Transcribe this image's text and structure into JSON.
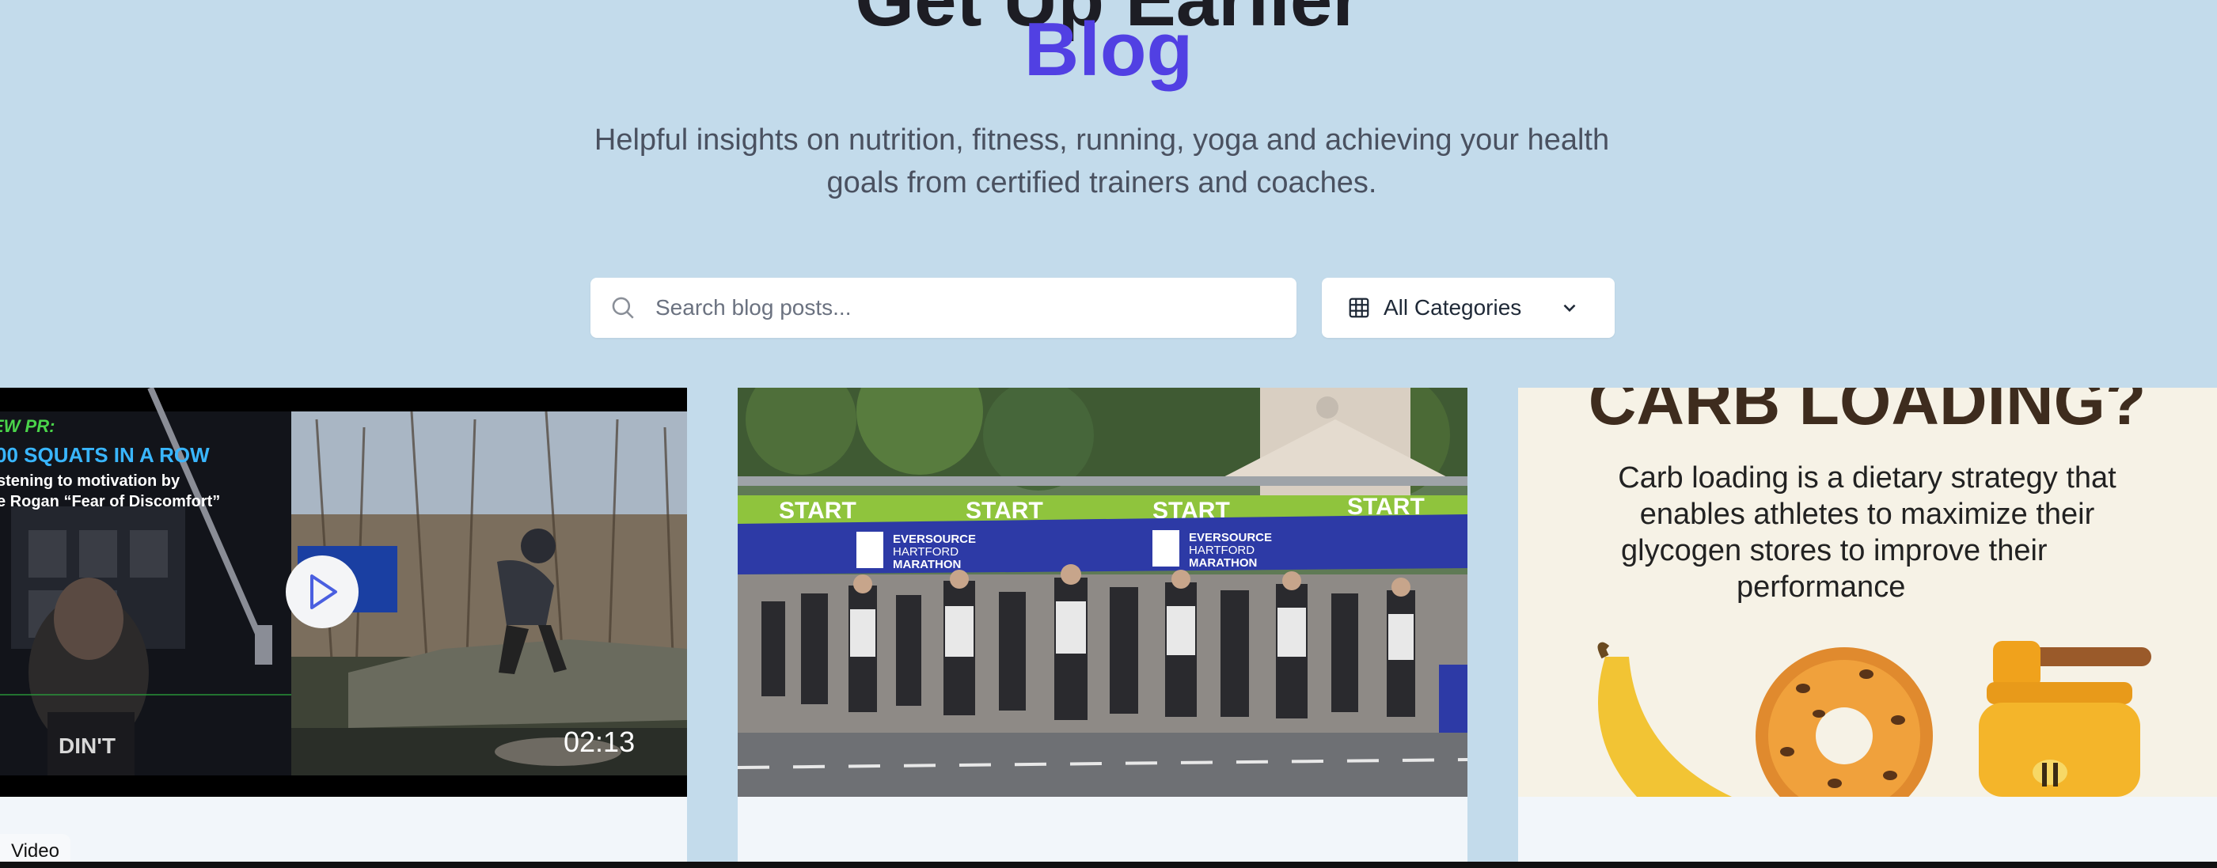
{
  "hero": {
    "title_top_partial": "Get Up Earlier",
    "title": "Blog",
    "subtitle_line1": "Helpful insights on nutrition, fitness, running, yoga and achieving your health",
    "subtitle_line2": "goals from certified trainers and coaches."
  },
  "search": {
    "placeholder": "Search blog posts...",
    "icon": "search-icon"
  },
  "category_filter": {
    "selected": "All Categories",
    "icon": "grid-icon",
    "dropdown_icon": "chevron-down-icon"
  },
  "cards": [
    {
      "type_badge": "Video",
      "duration": "02:13",
      "overlay_line1": "EW PR:",
      "overlay_line2": "00 SQUATS IN A ROW",
      "overlay_line3": "stening to motivation by",
      "overlay_line4": "e Rogan “Fear of Discomfort”",
      "overlay_box": "00",
      "play_icon": "play-icon"
    },
    {
      "banner_start": "START",
      "banner_brand_1": "EVERSOURCE",
      "banner_brand_2": "HARTFORD",
      "banner_brand_3": "MARATHON"
    },
    {
      "heading": "CARB LOADING?",
      "line1": "Carb loading is a dietary strategy that",
      "line2": "enables athletes to maximize their",
      "line3": "glycogen stores to improve their",
      "line4": "performance"
    }
  ],
  "colors": {
    "background": "#c3dbeb",
    "accent": "#5140e3",
    "text_muted": "#4a5160"
  }
}
